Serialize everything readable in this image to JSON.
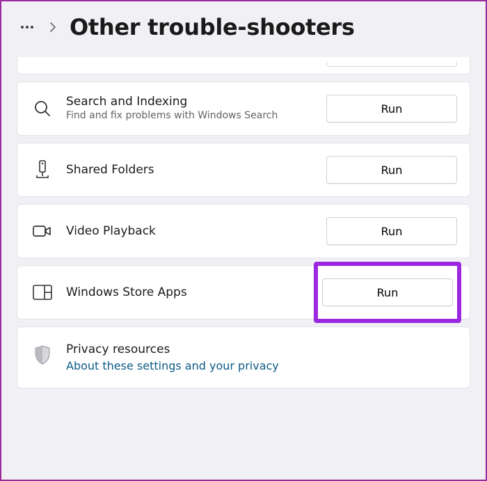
{
  "header": {
    "title": "Other trouble-shooters"
  },
  "items": [
    {
      "title": "Search and Indexing",
      "desc": "Find and fix problems with Windows Search",
      "button": "Run"
    },
    {
      "title": "Shared Folders",
      "button": "Run"
    },
    {
      "title": "Video Playback",
      "button": "Run"
    },
    {
      "title": "Windows Store Apps",
      "button": "Run"
    }
  ],
  "privacy": {
    "title": "Privacy resources",
    "link": "About these settings and your privacy"
  }
}
